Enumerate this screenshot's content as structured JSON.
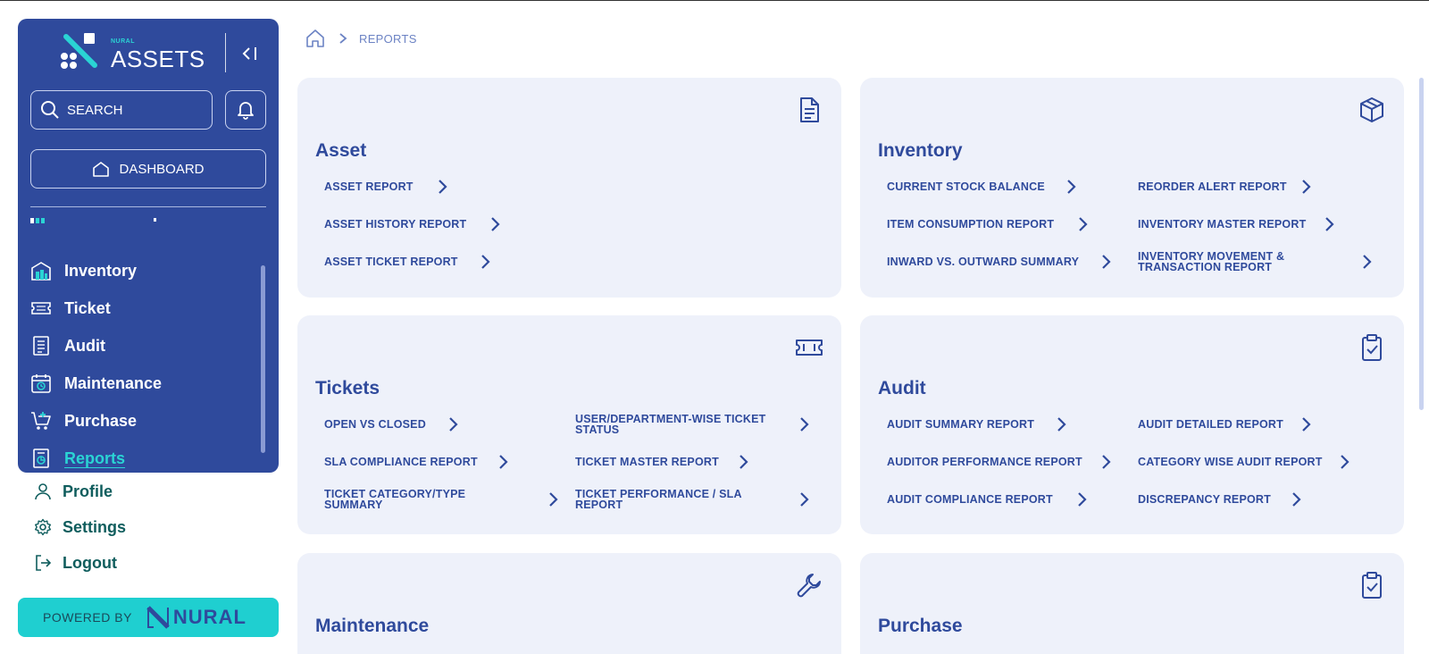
{
  "app": {
    "logo_small": "NURAL",
    "logo_big": "ASSETS"
  },
  "sidebar": {
    "search_placeholder": "SEARCH",
    "dashboard_label": "DASHBOARD",
    "items": [
      {
        "label": "Inventory",
        "icon": "inventory-icon"
      },
      {
        "label": "Ticket",
        "icon": "ticket-icon"
      },
      {
        "label": "Audit",
        "icon": "audit-icon"
      },
      {
        "label": "Maintenance",
        "icon": "maintenance-icon"
      },
      {
        "label": "Purchase",
        "icon": "purchase-icon"
      },
      {
        "label": "Reports",
        "icon": "reports-icon",
        "active": true
      }
    ],
    "bottom_links": [
      {
        "label": "Profile",
        "icon": "user-icon"
      },
      {
        "label": "Settings",
        "icon": "gear-icon"
      },
      {
        "label": "Logout",
        "icon": "logout-icon"
      }
    ],
    "powered_by": "POWERED BY",
    "powered_brand": "NURAL"
  },
  "breadcrumb": {
    "current": "REPORTS"
  },
  "cards": {
    "asset": {
      "title": "Asset",
      "links": [
        "ASSET REPORT",
        "ASSET HISTORY REPORT",
        "ASSET TICKET REPORT"
      ]
    },
    "inventory": {
      "title": "Inventory",
      "links_left": [
        "CURRENT STOCK BALANCE",
        "ITEM CONSUMPTION REPORT",
        "INWARD VS. OUTWARD SUMMARY"
      ],
      "links_right": [
        "REORDER ALERT REPORT",
        "INVENTORY MASTER REPORT",
        "INVENTORY MOVEMENT & TRANSACTION REPORT"
      ]
    },
    "tickets": {
      "title": "Tickets",
      "links_left": [
        "OPEN VS CLOSED",
        "SLA COMPLIANCE REPORT",
        "TICKET CATEGORY/TYPE SUMMARY"
      ],
      "links_right": [
        "USER/DEPARTMENT-WISE TICKET STATUS",
        "TICKET MASTER REPORT",
        "TICKET PERFORMANCE / SLA REPORT"
      ]
    },
    "audit": {
      "title": "Audit",
      "links_left": [
        "AUDIT SUMMARY REPORT",
        "AUDITOR PERFORMANCE REPORT",
        "AUDIT COMPLIANCE REPORT"
      ],
      "links_right": [
        "AUDIT DETAILED REPORT",
        "CATEGORY WISE AUDIT REPORT",
        "DISCREPANCY REPORT"
      ]
    },
    "maintenance": {
      "title": "Maintenance"
    },
    "purchase": {
      "title": "Purchase"
    }
  },
  "colors": {
    "sidebar_bg": "#2f4a9c",
    "accent": "#2ad4d4",
    "card_bg": "#eef1fa",
    "text_primary": "#2f4a9c"
  }
}
